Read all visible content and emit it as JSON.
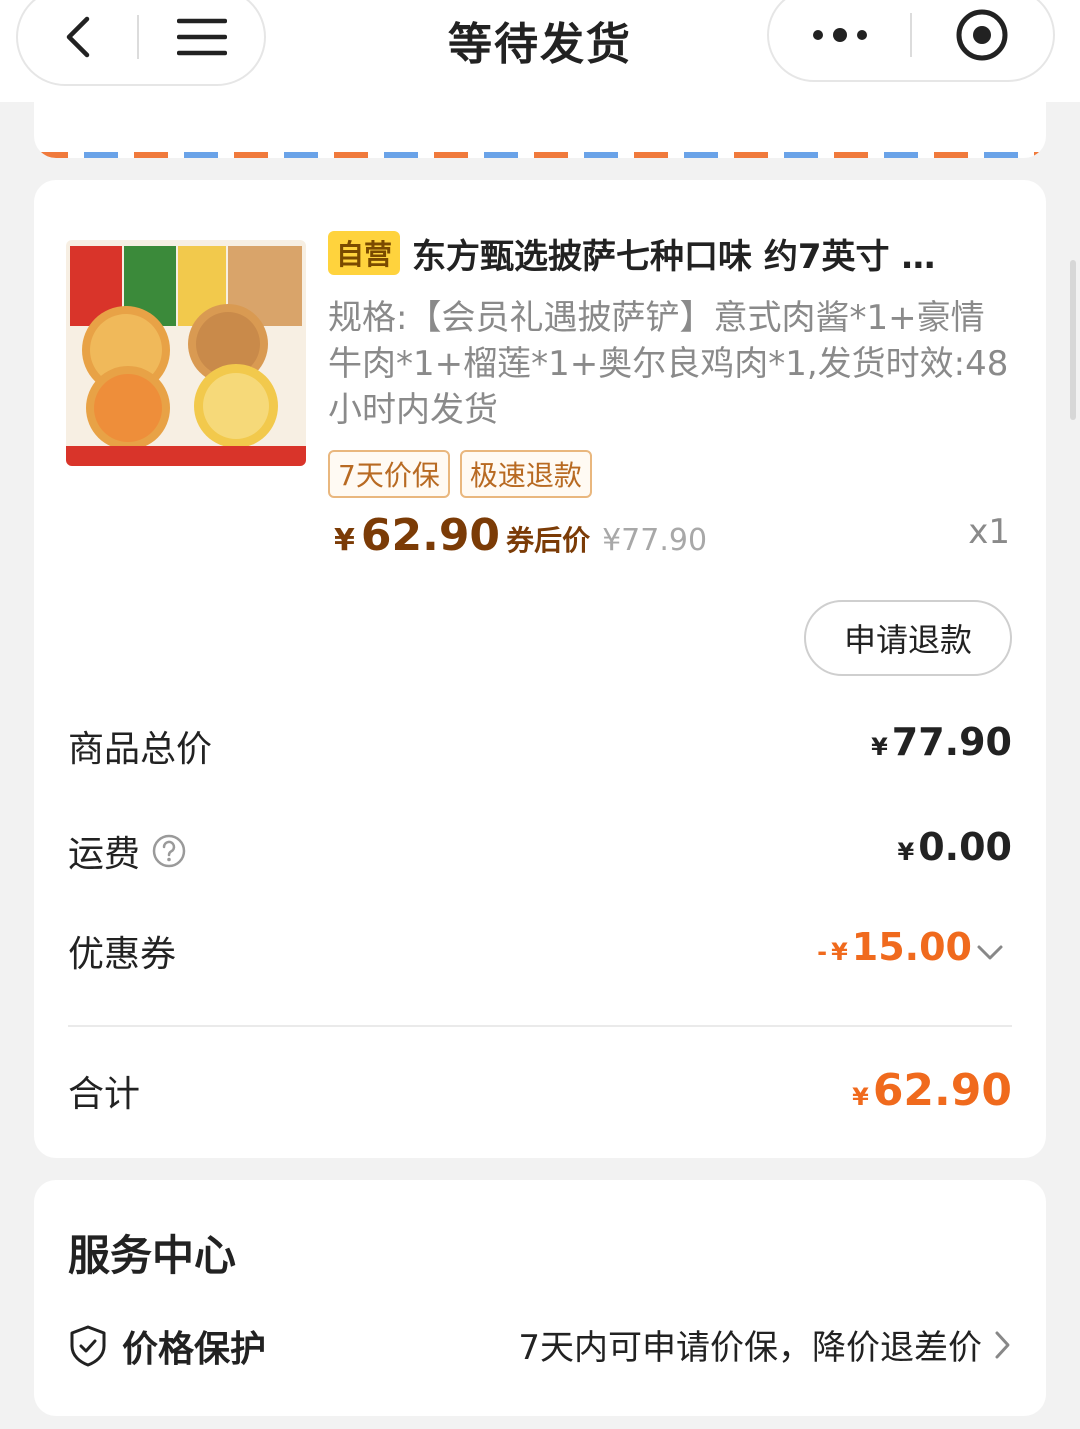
{
  "header": {
    "title": "等待发货",
    "back_icon": "chevron-left-icon",
    "menu_icon": "hamburger-icon",
    "more_icon": "more-dots-icon",
    "target_icon": "target-icon"
  },
  "product": {
    "tag": "自营",
    "title": "东方甄选披萨七种口味 约7英寸 …",
    "spec": "规格:【会员礼遇披萨铲】意式肉酱*1+豪情牛肉*1+榴莲*1+奥尔良鸡肉*1,发货时效:48小时内发货",
    "badges": [
      "7天价保",
      "极速退款"
    ],
    "price_yen": "¥",
    "price": "62.90",
    "price_after_label": "券后价",
    "original_price": "¥77.90",
    "quantity": "x1",
    "refund_button": "申请退款"
  },
  "summary": {
    "total_goods_label": "商品总价",
    "total_goods_value": "77.90",
    "shipping_label": "运费",
    "shipping_value": "0.00",
    "coupon_label": "优惠券",
    "coupon_value": "15.00",
    "total_label": "合计",
    "total_value": "62.90",
    "yen": "¥",
    "minus": "-"
  },
  "service": {
    "title": "服务中心",
    "price_protect_label": "价格保护",
    "price_protect_desc": "7天内可申请价保，降价退差价"
  },
  "colors": {
    "accent_orange": "#f06a1d",
    "price_brown": "#7b3b06",
    "tag_yellow": "#ffd33d"
  }
}
